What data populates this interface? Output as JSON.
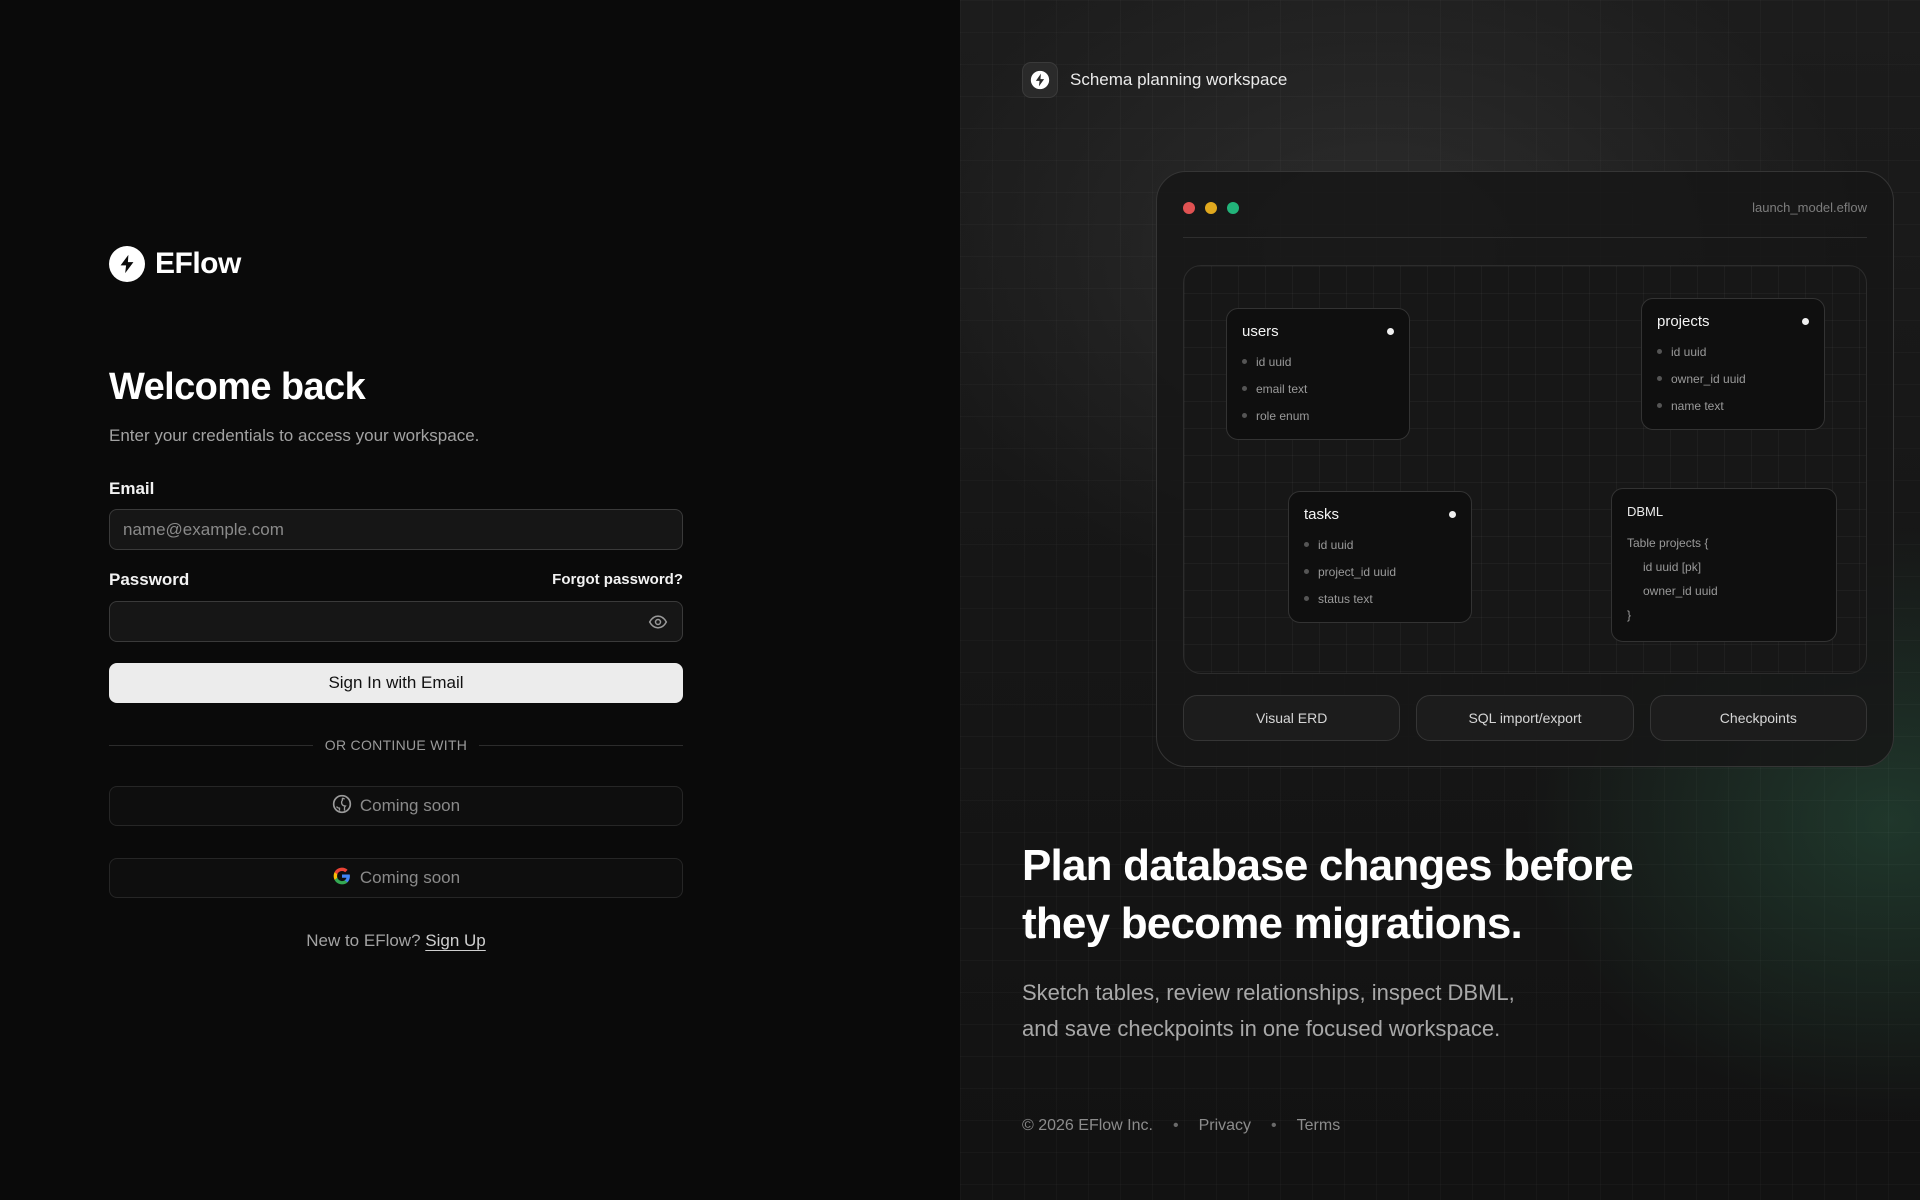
{
  "brand": {
    "name": "EFlow",
    "logo_icon": "bolt-icon"
  },
  "login": {
    "title": "Welcome back",
    "subtitle": "Enter your credentials to access your workspace.",
    "email_label": "Email",
    "email_placeholder": "name@example.com",
    "email_value": "",
    "password_label": "Password",
    "password_value": "",
    "forgot_label": "Forgot password?",
    "submit_label": "Sign In with Email",
    "divider_text": "OR CONTINUE WITH",
    "github_label": "Coming soon",
    "google_label": "Coming soon",
    "signup_prompt": "New to EFlow?",
    "signup_link": "Sign Up"
  },
  "promo": {
    "badge_text": "Schema planning workspace",
    "window": {
      "filename": "launch_model.eflow",
      "dot_colors": [
        "#e05252",
        "#e0a81e",
        "#22b47a"
      ],
      "tables": [
        {
          "name": "users",
          "columns": [
            "id uuid",
            "email text",
            "role enum"
          ]
        },
        {
          "name": "projects",
          "columns": [
            "id uuid",
            "owner_id uuid",
            "name text"
          ]
        },
        {
          "name": "tasks",
          "columns": [
            "id uuid",
            "project_id uuid",
            "status text"
          ]
        }
      ],
      "dbml": {
        "title": "DBML",
        "lines": [
          "Table projects {",
          "id uuid [pk]",
          "owner_id uuid",
          "}"
        ]
      },
      "features": [
        "Visual ERD",
        "SQL import/export",
        "Checkpoints"
      ]
    },
    "headline_line1": "Plan database changes before",
    "headline_line2": "they become migrations.",
    "desc_line1": "Sketch tables, review relationships, inspect DBML,",
    "desc_line2": "and save checkpoints in one focused workspace.",
    "footer": {
      "copyright": "© 2026 EFlow Inc.",
      "separator": "•",
      "privacy": "Privacy",
      "terms": "Terms"
    }
  }
}
